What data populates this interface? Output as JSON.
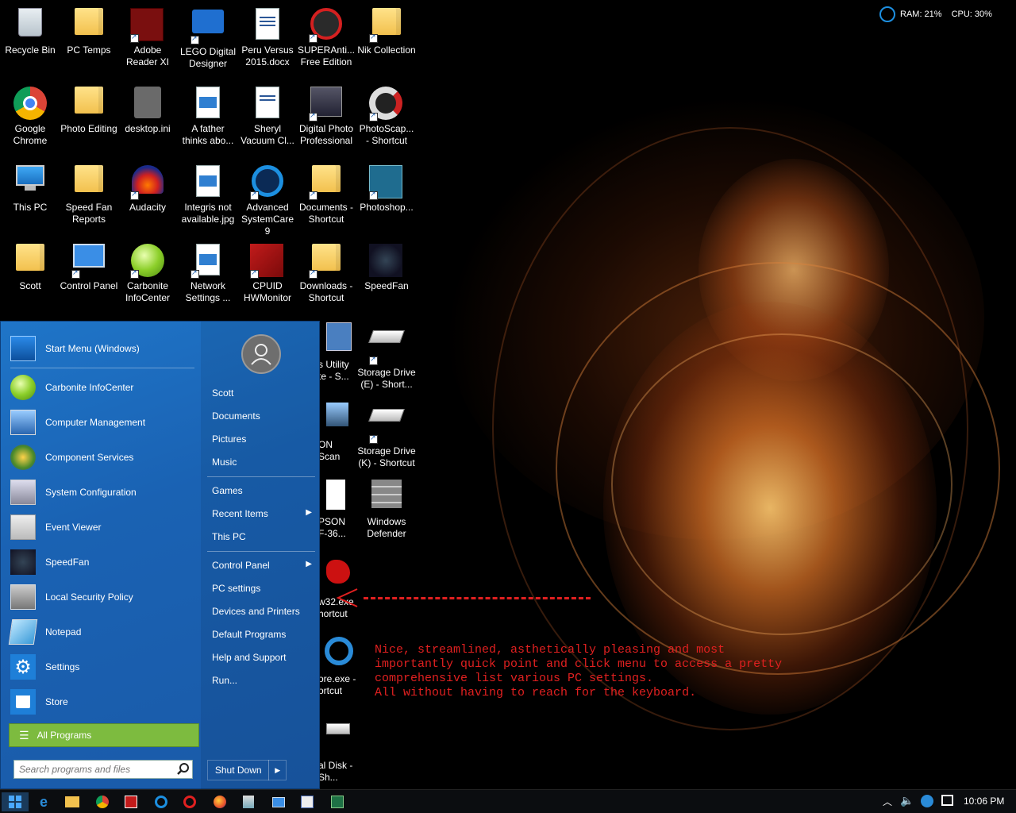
{
  "perf_widget": {
    "ram": "RAM: 21%",
    "cpu": "CPU: 30%"
  },
  "desktop_icons": {
    "recycle_bin": "Recycle Bin",
    "pc_temps": "PC Temps",
    "adobe_reader": "Adobe Reader XI",
    "lego": "LEGO Digital Designer",
    "peru": "Peru Versus 2015.docx",
    "superanti": "SUPERAnti... Free Edition",
    "nik": "Nik Collection",
    "chrome": "Google Chrome",
    "photo_editing": "Photo Editing",
    "desktop_ini": "desktop.ini",
    "a_father": "A father thinks abo...",
    "sheryl": "Sheryl Vacuum Cl...",
    "digital_photo": "Digital Photo Professional",
    "photoscape": "PhotoScap... - Shortcut",
    "this_pc": "This PC",
    "speedfan_reports": "Speed Fan Reports",
    "audacity": "Audacity",
    "integris": "Integris not available.jpg",
    "advanced_systemcare": "Advanced SystemCare 9",
    "documents": "Documents - Shortcut",
    "photoshop": "Photoshop...",
    "scott": "Scott",
    "control_panel": "Control Panel",
    "carbonite": "Carbonite InfoCenter",
    "network_settings": "Network Settings ...",
    "cpuid": "CPUID HWMonitor",
    "downloads": "Downloads - Shortcut",
    "speedfan": "SpeedFan",
    "utility": "s Utility te - S...",
    "storage_e": "Storage Drive (E) - Short...",
    "on_scan": "ON Scan",
    "storage_k": "Storage Drive (K) - Shortcut",
    "pson": "PSON F-36...",
    "windows_defender": "Windows Defender",
    "w32": "w32.exe hortcut",
    "ore_exe": "ore.exe - ortcut",
    "local_disk": "al Disk - Sh..."
  },
  "annotation": "Nice, streamlined, asthetically pleasing and most\nimportantly quick point and click menu to access a pretty\ncomprehensive list various PC settings.\nAll without having to reach for the keyboard.",
  "start_menu": {
    "pinned": "Start Menu (Windows)",
    "programs": [
      "Carbonite InfoCenter",
      "Computer Management",
      "Component Services",
      "System Configuration",
      "Event Viewer",
      "SpeedFan",
      "Local Security Policy",
      "Notepad",
      "Settings",
      "Store"
    ],
    "all_programs": "All Programs",
    "search_placeholder": "Search programs and files",
    "right": {
      "user": "Scott",
      "documents": "Documents",
      "pictures": "Pictures",
      "music": "Music",
      "games": "Games",
      "recent_items": "Recent Items",
      "this_pc": "This PC",
      "control_panel": "Control Panel",
      "pc_settings": "PC settings",
      "devices_printers": "Devices and Printers",
      "default_programs": "Default Programs",
      "help_support": "Help and Support",
      "run": "Run..."
    },
    "shutdown": "Shut Down"
  },
  "taskbar": {
    "clock": "10:06 PM"
  },
  "colors": {
    "start_blue": "#1a62b3",
    "all_programs_green": "#7dbb3f",
    "annotation_red": "#e02020"
  }
}
